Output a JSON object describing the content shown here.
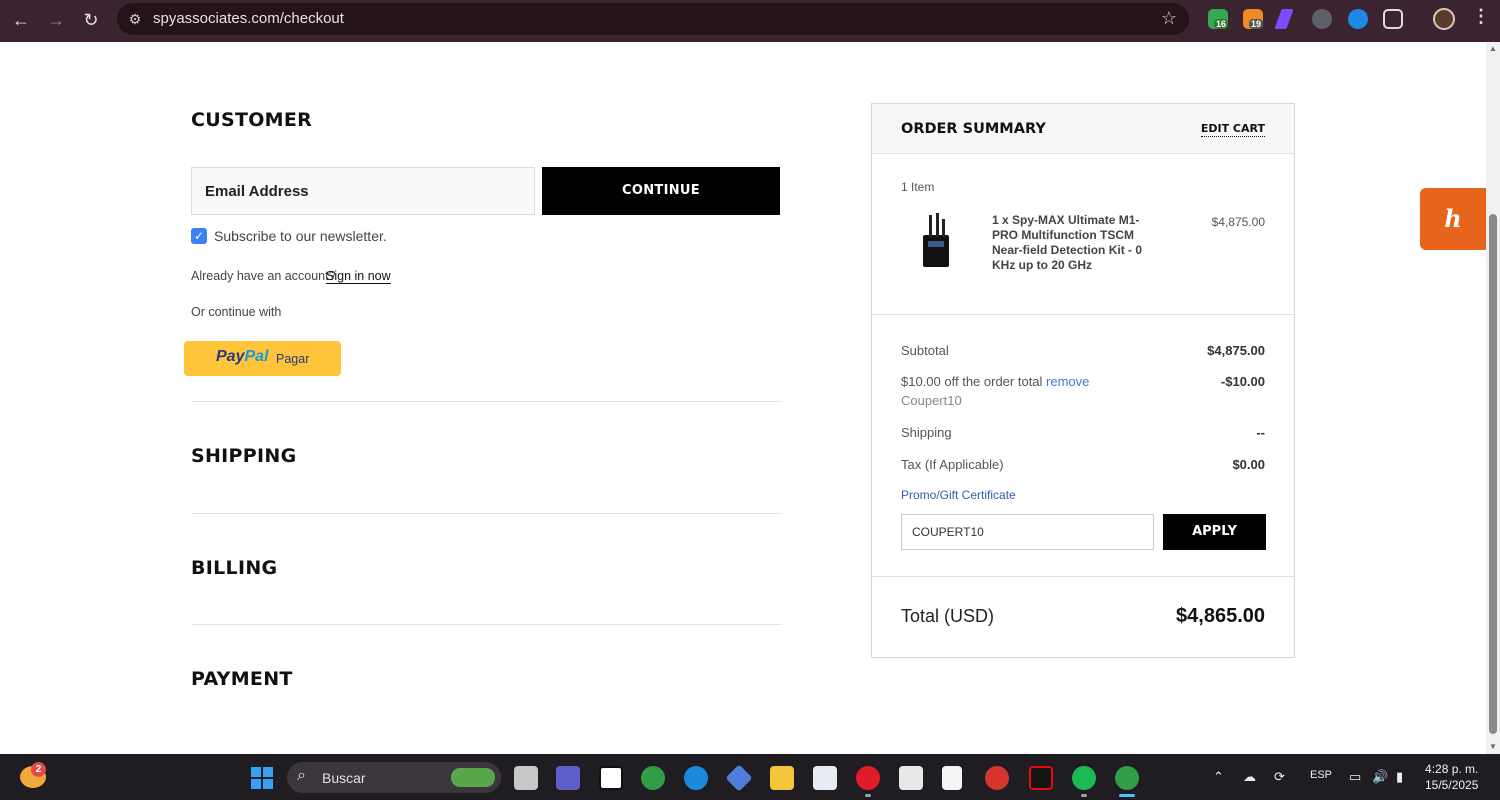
{
  "browser": {
    "url": "spyassociates.com/checkout",
    "ext_badges": [
      "16",
      "19"
    ]
  },
  "customer": {
    "title": "CUSTOMER",
    "email_placeholder": "Email Address",
    "continue_label": "CONTINUE",
    "newsletter_label": "Subscribe to our newsletter.",
    "newsletter_checked": true,
    "account_prompt": "Already have an account?",
    "signin_label": "Sign in now",
    "or_continue": "Or continue with",
    "paypal_brand_1": "Pay",
    "paypal_brand_2": "Pal",
    "paypal_action": "Pagar"
  },
  "sections": {
    "shipping": "SHIPPING",
    "billing": "BILLING",
    "payment": "PAYMENT"
  },
  "summary": {
    "title": "ORDER SUMMARY",
    "edit_cart": "EDIT CART",
    "items_count": "1 Item",
    "product_name": "1 x Spy-MAX Ultimate M1- PRO Multifunction TSCM Near-field Detection Kit - 0 KHz up to 20 GHz",
    "product_price": "$4,875.00",
    "subtotal_label": "Subtotal",
    "subtotal_value": "$4,875.00",
    "discount_label": "$10.00 off the order total",
    "discount_remove": "remove",
    "discount_value": "-$10.00",
    "coupon_code": "Coupert10",
    "shipping_label": "Shipping",
    "shipping_value": "--",
    "tax_label": "Tax (If Applicable)",
    "tax_value": "$0.00",
    "promo_label": "Promo/Gift Certificate",
    "promo_value": "COUPERT10",
    "apply_label": "APPLY",
    "total_label": "Total (USD)",
    "total_value": "$4,865.00"
  },
  "honey": {
    "label": "h"
  },
  "taskbar": {
    "search_label": "Buscar",
    "weather_badge": "2",
    "language": "ESP",
    "time": "4:28 p. m.",
    "date": "15/5/2025"
  },
  "colors": {
    "chrome_bg": "#3b2330",
    "button_black": "#000000",
    "paypal_yellow": "#ffc439",
    "honey_orange": "#e6641c",
    "link_blue": "#3a7bd5",
    "taskbar_bg": "#1f1c22"
  }
}
